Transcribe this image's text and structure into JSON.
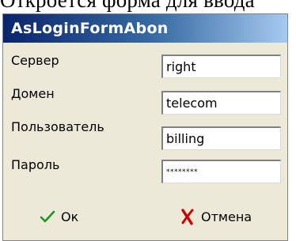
{
  "document": {
    "caption_fragment": "Откроется форма  для ввода"
  },
  "window": {
    "title": "AsLoginFormAbon"
  },
  "fields": [
    {
      "label": "Сервер",
      "value": "right"
    },
    {
      "label": "Домен",
      "value": "telecom"
    },
    {
      "label": "Пользователь",
      "value": "billing"
    },
    {
      "label": "Пароль",
      "value": "********"
    }
  ],
  "buttons": {
    "ok_label": "Ок",
    "cancel_label": "Отмена"
  },
  "icons": {
    "ok": "checkmark-icon",
    "cancel": "red-x-icon"
  },
  "colors": {
    "title_gradient_start": "#0a246a",
    "title_gradient_end": "#a6caf0",
    "checkmark": "#1a9a1a",
    "cancel_x": "#cc0000",
    "window_bg": "#ece9d8"
  }
}
